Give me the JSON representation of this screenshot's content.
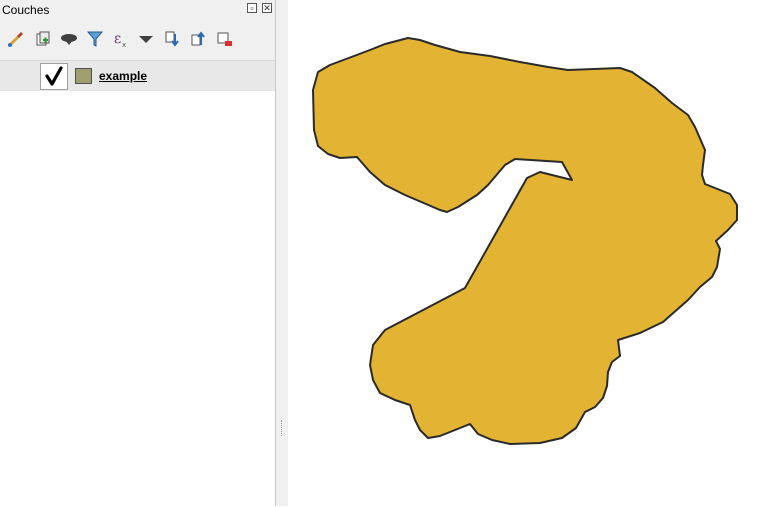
{
  "panel": {
    "title": "Couches"
  },
  "toolbar": {
    "tools": [
      {
        "icon": "paintbrush-style-icon"
      },
      {
        "icon": "add-group-icon"
      },
      {
        "icon": "manage-visibility-icon"
      },
      {
        "icon": "filter-legend-icon"
      },
      {
        "icon": "filter-expression-icon"
      },
      {
        "icon": "dropdown-arrow-icon"
      },
      {
        "icon": "expand-all-icon"
      },
      {
        "icon": "collapse-all-icon"
      },
      {
        "icon": "remove-layer-icon"
      }
    ]
  },
  "layers": [
    {
      "name": "example",
      "visible": true,
      "swatch_color": "#a0a06e"
    }
  ],
  "map": {
    "polygon_fill": "#e3b433",
    "polygon_stroke": "#2a2a2a"
  }
}
